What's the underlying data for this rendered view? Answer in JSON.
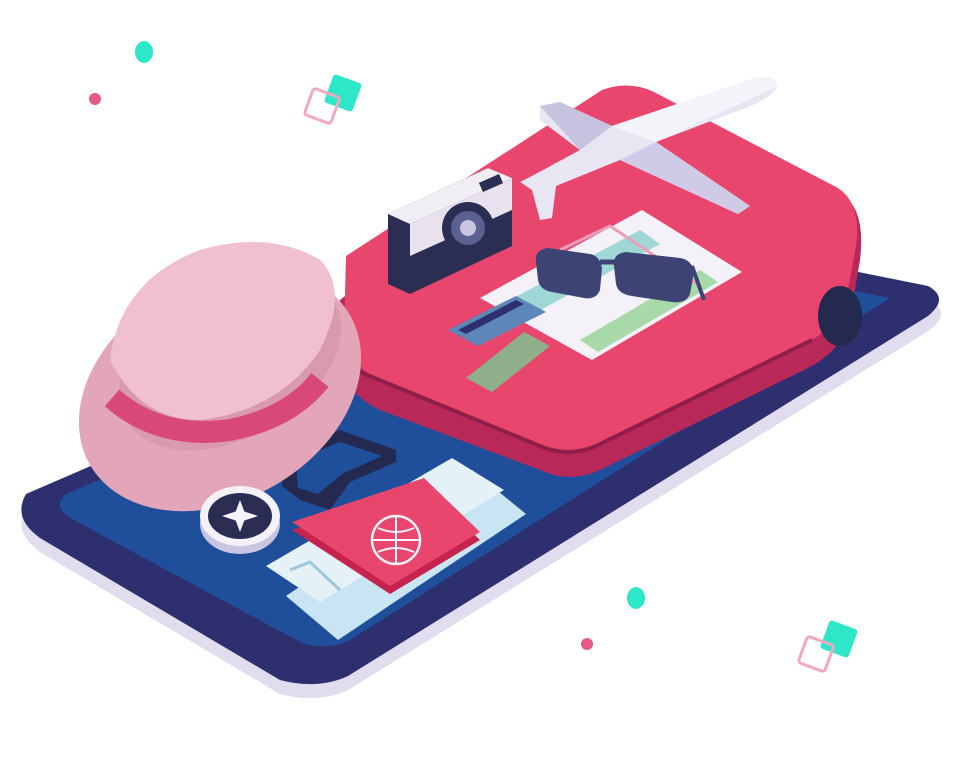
{
  "illustration": {
    "subject": "travel-on-smartphone",
    "icons": [
      "airplane-icon",
      "camera-icon",
      "sunglasses-icon",
      "map-icon",
      "credit-card-icon",
      "hat-icon",
      "compass-icon",
      "passport-icon",
      "boarding-pass-icon",
      "suitcase-icon"
    ]
  },
  "colors": {
    "phone_shadow": "#e2dcef",
    "phone_body": "#2e2f6e",
    "phone_screen": "#1f4f9a",
    "suitcase_main": "#e9466e",
    "suitcase_dark": "#b8295a",
    "hat_main": "#e3a6b8",
    "hat_band": "#d9487a",
    "accent_teal": "#2ee6c8",
    "accent_pink": "#e45a86"
  }
}
